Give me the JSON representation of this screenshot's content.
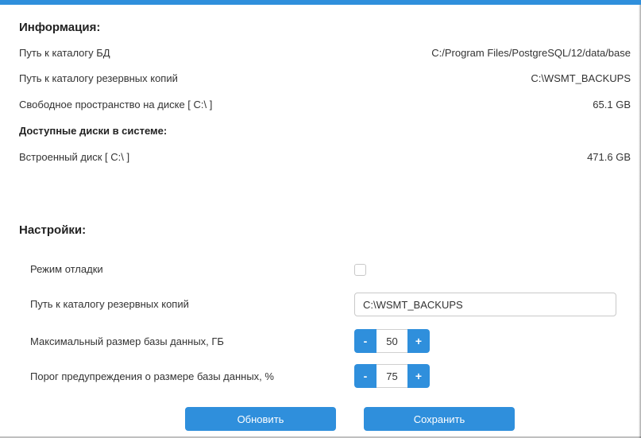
{
  "colors": {
    "accent": "#2f8fdc"
  },
  "info": {
    "title": "Информация:",
    "rows": [
      {
        "label": "Путь к каталогу БД",
        "value": "C:/Program Files/PostgreSQL/12/data/base"
      },
      {
        "label": "Путь к каталогу резервных копий",
        "value": "C:\\WSMT_BACKUPS"
      },
      {
        "label": "Свободное пространство на диске [ C:\\ ]",
        "value": "65.1 GB"
      }
    ],
    "disks_title": "Доступные диски в системе:",
    "disks": [
      {
        "label": "Встроенный диск [ C:\\ ]",
        "value": "471.6 GB"
      }
    ]
  },
  "settings": {
    "title": "Настройки:",
    "debug_label": "Режим отладки",
    "debug_checked": false,
    "backup_path_label": "Путь к каталогу резервных копий",
    "backup_path_value": "C:\\WSMT_BACKUPS",
    "max_db_size_label": "Максимальный размер базы данных, ГБ",
    "max_db_size_value": "50",
    "warn_threshold_label": "Порог предупреждения о размере базы данных, %",
    "warn_threshold_value": "75",
    "minus_label": "-",
    "plus_label": "+"
  },
  "actions": {
    "refresh_label": "Обновить",
    "save_label": "Сохранить"
  }
}
